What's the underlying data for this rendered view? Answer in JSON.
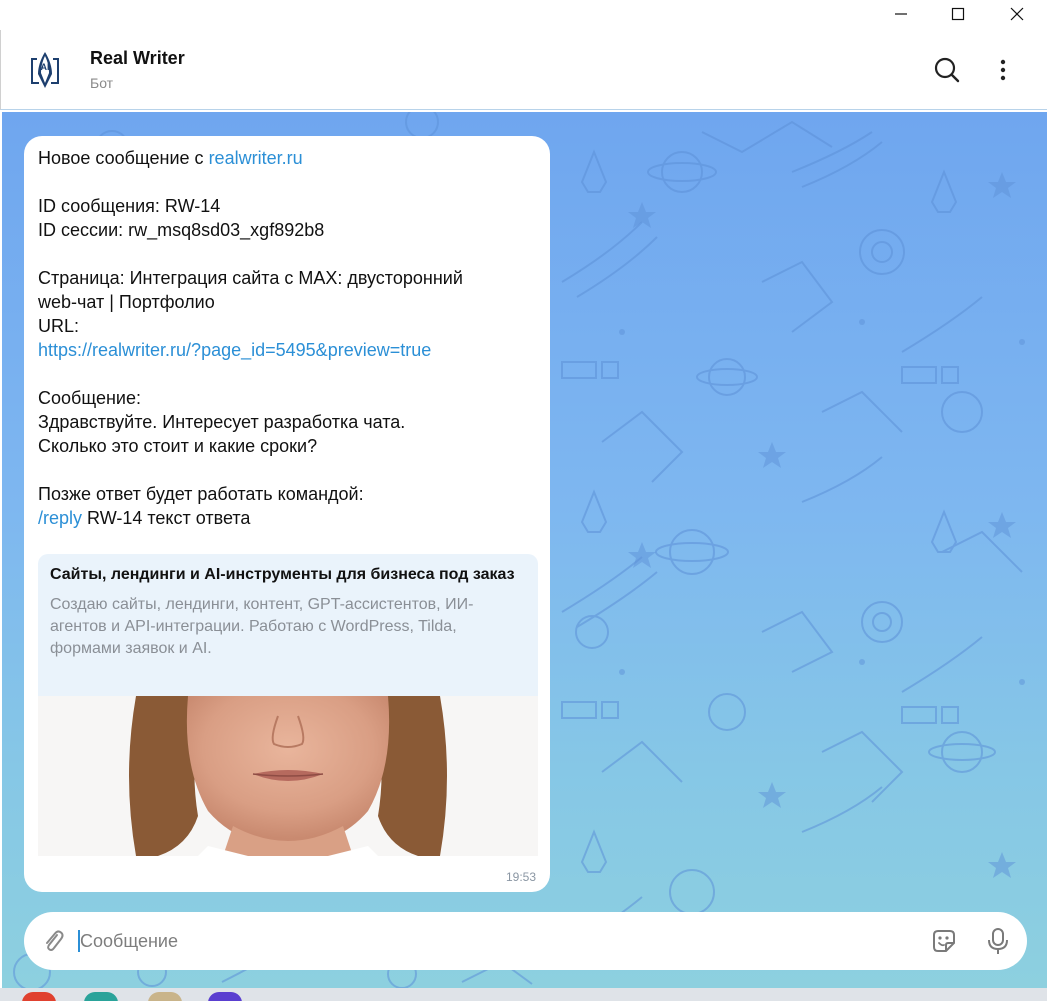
{
  "window": {
    "minimize": "—",
    "maximize": "☐",
    "close": "✕"
  },
  "header": {
    "title": "Real Writer",
    "subtitle": "Бот",
    "avatar_icon": "fountain-pen-ai-logo",
    "search_icon": "search-icon",
    "menu_icon": "more-vertical-icon"
  },
  "message": {
    "line1_prefix": "Новое сообщение с ",
    "line1_link": "realwriter.ru",
    "message_id": "ID сообщения: RW-14",
    "session_id": "ID сессии: rw_msq8sd03_xgf892b8",
    "page_line1": "Страница: Интеграция сайта с MAX: двусторонний",
    "page_line2": "web-чат | Портфолио",
    "url_label": "URL:",
    "url_link": "https://realwriter.ru/?page_id=5495&preview=true",
    "msg_label": "Сообщение:",
    "msg_line1": "Здравствуйте. Интересует разработка чата.",
    "msg_line2": "Сколько это стоит и какие сроки?",
    "reply_hint": "Позже ответ будет работать командой:",
    "reply_cmd": "/reply",
    "reply_rest": " RW-14 текст ответа",
    "time": "19:53"
  },
  "preview": {
    "title": "Сайты, лендинги и AI-инструменты для бизнеса под заказ",
    "description": "Создаю сайты, лендинги, контент, GPT-ассистентов, ИИ-агентов и API-интеграции. Работаю с WordPress, Tilda, формами заявок и AI."
  },
  "input": {
    "placeholder": "Сообщение",
    "value": ""
  },
  "colors": {
    "accent": "#2b8fd6",
    "chat_bg_top": "#6fa6ef",
    "chat_bg_bottom": "#8dd0df"
  }
}
